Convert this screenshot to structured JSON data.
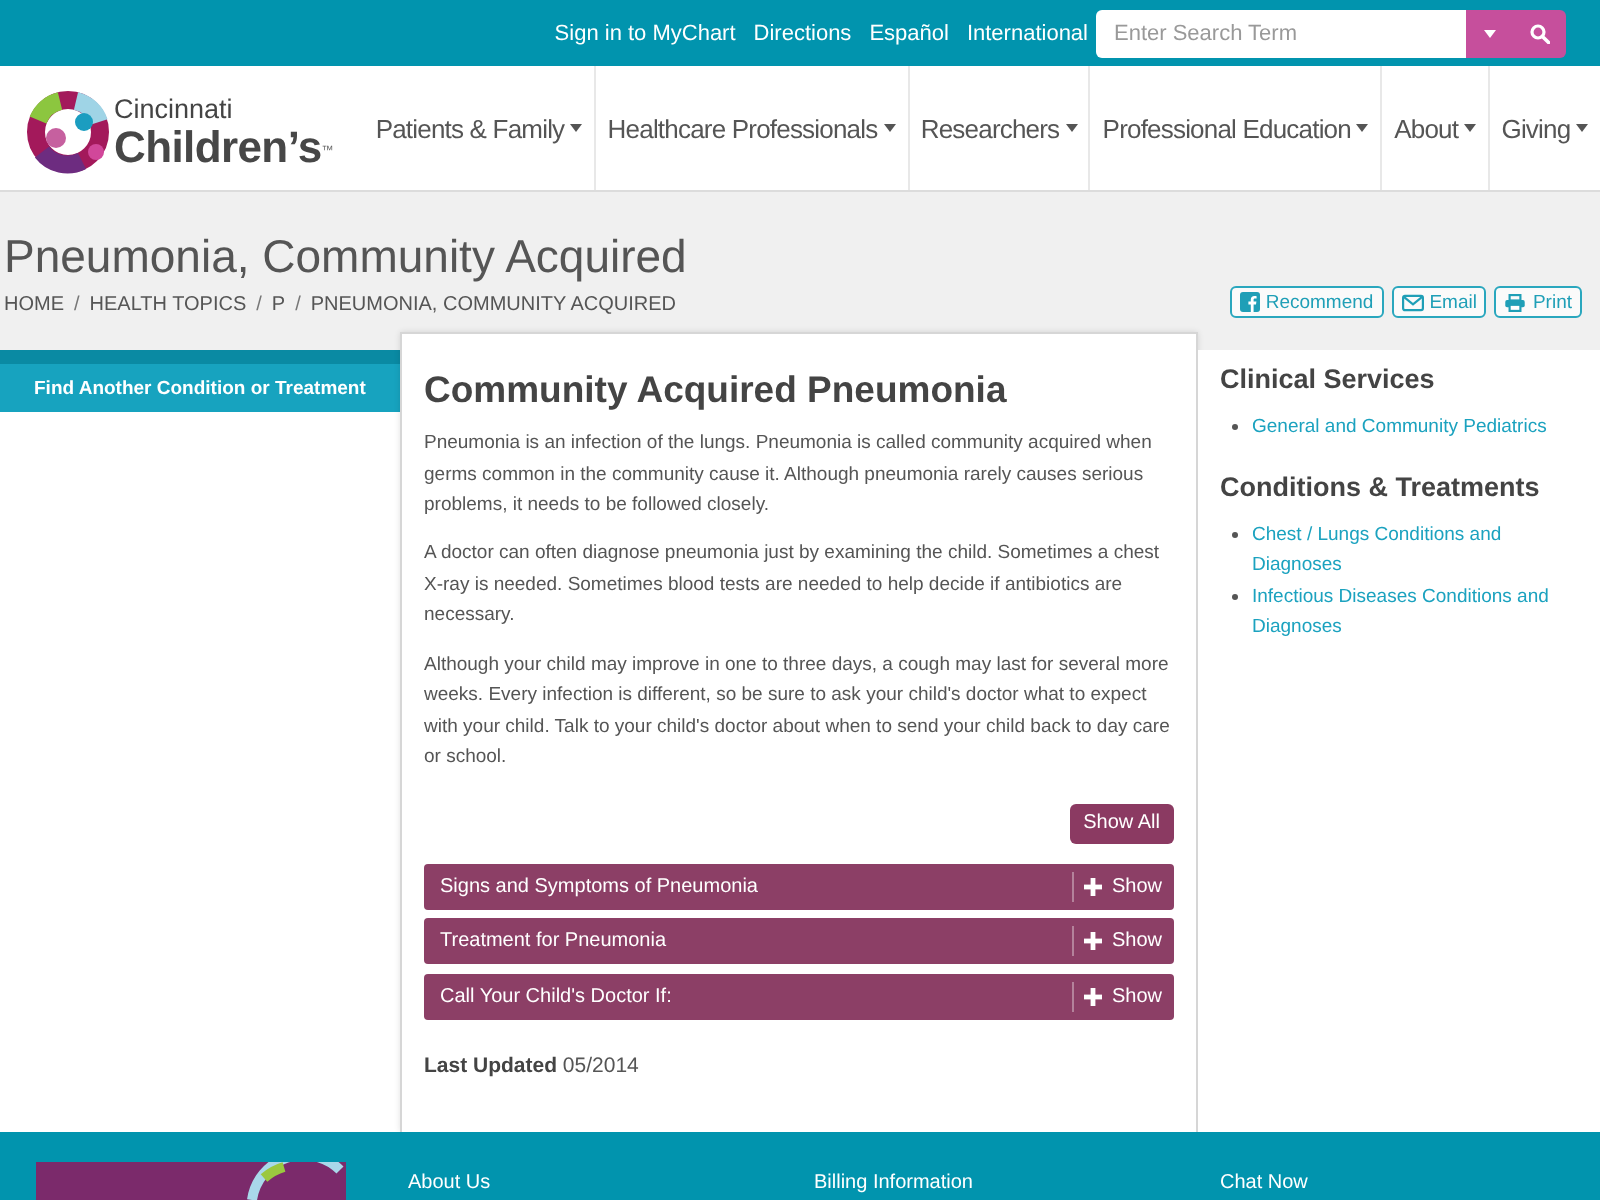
{
  "top_bar": {
    "links": [
      "Sign in to MyChart",
      "Directions",
      "Español",
      "International"
    ],
    "search": {
      "placeholder": "Enter Search Term"
    }
  },
  "logo": {
    "line1": "Cincinnati",
    "line2": "Children’s",
    "trademark": "™"
  },
  "nav": {
    "items": [
      "Patients & Family",
      "Healthcare Professionals",
      "Researchers",
      "Professional Education",
      "About",
      "Giving"
    ]
  },
  "page_title": "Pneumonia, Community Acquired",
  "breadcrumb": {
    "separator": "/",
    "items": [
      "HOME",
      "HEALTH TOPICS",
      "P",
      "PNEUMONIA, COMMUNITY ACQUIRED"
    ]
  },
  "share_buttons": [
    {
      "kind": "facebook",
      "label": "Recommend"
    },
    {
      "kind": "email",
      "label": "Email"
    },
    {
      "kind": "print",
      "label": "Print"
    }
  ],
  "sidebar": {
    "button": "Find Another Condition or Treatment"
  },
  "article": {
    "heading": "Community Acquired Pneumonia",
    "paragraphs": [
      "Pneumonia is an infection of the lungs. Pneumonia is called community acquired when germs common in the community cause it. Although pneumonia rarely causes serious problems, it needs to be followed closely.",
      "A doctor can often diagnose pneumonia just by examining the child. Sometimes a chest X-ray is needed. Sometimes blood tests are needed to help decide if antibiotics are necessary.",
      "Although your child may improve in one to three days, a cough may last for several more weeks. Every infection is different, so be sure to ask your child's doctor what to expect with your child. Talk to your child's doctor about when to send your child back to day care or school."
    ],
    "show_all": "Show All",
    "sections": [
      {
        "title": "Signs and Symptoms of Pneumonia",
        "toggle": "Show",
        "expanded": false
      },
      {
        "title": "Treatment for Pneumonia",
        "toggle": "Show",
        "expanded": false
      },
      {
        "title": "Call Your Child's Doctor If:",
        "toggle": "Show",
        "expanded": false
      }
    ],
    "last_updated": "**Last Updated** 05/2014"
  },
  "related": [
    {
      "heading": "Clinical Services",
      "links": [
        "General and Community Pediatrics"
      ]
    },
    {
      "heading": "Conditions & Treatments",
      "links": [
        "Chest / Lungs Conditions and Diagnoses",
        "Infectious Diseases Conditions and Diagnoses"
      ]
    }
  ],
  "footer": {
    "links": [
      "About Us",
      "Billing Information",
      "Chat Now"
    ]
  }
}
